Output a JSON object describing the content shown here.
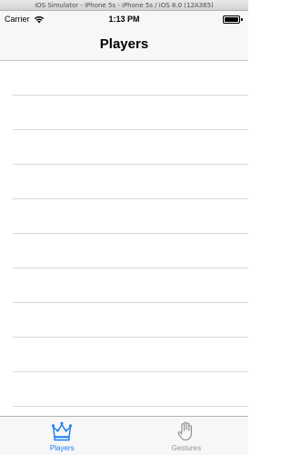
{
  "simulator": {
    "title": "iOS Simulator - iPhone 5s - iPhone 5s / iOS 8.0 (12A365)"
  },
  "status_bar": {
    "carrier": "Carrier",
    "time": "1:13 PM",
    "icons": [
      "wifi-icon",
      "battery-icon"
    ]
  },
  "nav": {
    "title": "Players"
  },
  "table": {
    "rows": [
      "",
      "",
      "",
      "",
      "",
      "",
      "",
      "",
      "",
      ""
    ]
  },
  "tab_bar": {
    "items": [
      {
        "label": "Players",
        "icon": "crown-icon",
        "selected": true
      },
      {
        "label": "Gestures",
        "icon": "hand-icon",
        "selected": false
      }
    ]
  },
  "colors": {
    "tint": "#1a7cf8",
    "inactive": "#929292",
    "bar_background": "#f7f7f7",
    "separator": "#d9d9dc"
  }
}
